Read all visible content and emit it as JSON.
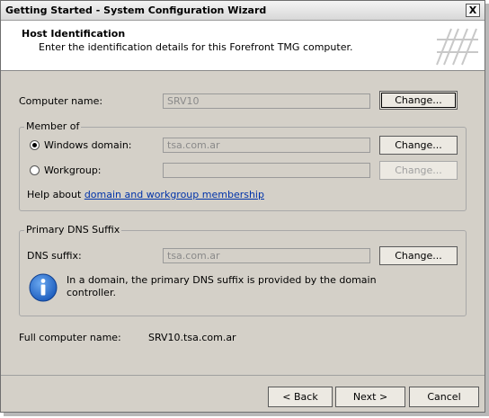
{
  "window": {
    "title": "Getting Started - System Configuration Wizard",
    "close_glyph": "X"
  },
  "header": {
    "title": "Host Identification",
    "subtitle": "Enter the identification details for this Forefront TMG computer."
  },
  "computer_name": {
    "label": "Computer name:",
    "value": "SRV10",
    "change_label": "Change..."
  },
  "member_of": {
    "legend": "Member of",
    "windows_domain": {
      "label": "Windows domain:",
      "value": "tsa.com.ar",
      "selected": true,
      "change_label": "Change..."
    },
    "workgroup": {
      "label": "Workgroup:",
      "value": "",
      "selected": false,
      "change_label": "Change..."
    },
    "help_prefix": "Help about ",
    "help_link": "domain and workgroup membership"
  },
  "dns": {
    "legend": "Primary DNS Suffix",
    "label": "DNS suffix:",
    "value": "tsa.com.ar",
    "change_label": "Change...",
    "info_line1": "In a domain, the primary DNS suffix is provided by the domain",
    "info_line2": "controller."
  },
  "full_name": {
    "label": "Full computer name:",
    "value": "SRV10.tsa.com.ar"
  },
  "footer": {
    "back_label": "< Back",
    "next_label": "Next >",
    "cancel_label": "Cancel"
  },
  "icons": {
    "info": "info-icon",
    "close": "close-icon",
    "header_logo": "wizard-logo"
  },
  "colors": {
    "dialog_bg": "#d4d0c8",
    "link": "#0033aa",
    "info_icon_blue": "#1f5fbf"
  }
}
